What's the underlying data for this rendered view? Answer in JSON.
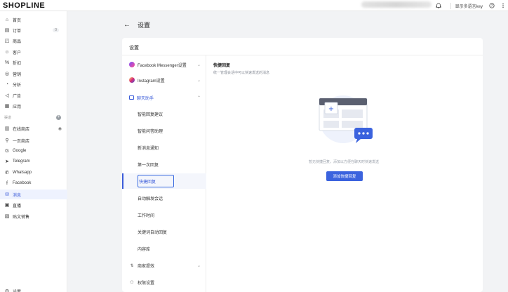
{
  "topbar": {
    "logo": "SHOPLINE",
    "lang_label": "显示多语言key",
    "icons": [
      "bell-icon",
      "help-icon",
      "more-icon"
    ]
  },
  "sidebar": {
    "items": [
      {
        "label": "首页",
        "icon": "home-icon"
      },
      {
        "label": "订单",
        "icon": "order-icon",
        "badge": "0"
      },
      {
        "label": "商品",
        "icon": "product-icon"
      },
      {
        "label": "客户",
        "icon": "customer-icon"
      },
      {
        "label": "折扣",
        "icon": "discount-icon"
      },
      {
        "label": "营销",
        "icon": "marketing-icon"
      },
      {
        "label": "分析",
        "icon": "analytics-icon"
      },
      {
        "label": "广告",
        "icon": "ads-icon"
      },
      {
        "label": "应用",
        "icon": "apps-icon"
      }
    ],
    "section_label": "渠道",
    "channels": [
      {
        "label": "在线商店",
        "icon": "store-icon"
      },
      {
        "label": "一页商店",
        "icon": "one-page-icon"
      },
      {
        "label": "Google",
        "icon": "google-icon"
      },
      {
        "label": "Telegram",
        "icon": "telegram-icon"
      },
      {
        "label": "Whatsapp",
        "icon": "whatsapp-icon"
      },
      {
        "label": "Facebook",
        "icon": "facebook-icon"
      },
      {
        "label": "消息",
        "icon": "message-icon",
        "active": true
      },
      {
        "label": "直播",
        "icon": "live-icon"
      },
      {
        "label": "贴文销售",
        "icon": "post-sale-icon"
      }
    ],
    "footer_label": "设置"
  },
  "page": {
    "title": "设置",
    "card_title": "设置"
  },
  "menu": {
    "items": [
      {
        "label": "Facebook Messenger设置",
        "icon": "messenger-icon",
        "type": "group"
      },
      {
        "label": "Instagram设置",
        "icon": "instagram-icon",
        "type": "group"
      },
      {
        "label": "聊天助手",
        "icon": "chat-assistant-icon",
        "type": "group-open"
      },
      {
        "label": "智能回复建议",
        "type": "sub"
      },
      {
        "label": "智能问答助理",
        "type": "sub"
      },
      {
        "label": "新消息通知",
        "type": "sub"
      },
      {
        "label": "第一次回复",
        "type": "sub"
      },
      {
        "label": "快捷回复",
        "type": "sub",
        "active": true
      },
      {
        "label": "自动触发会话",
        "type": "sub"
      },
      {
        "label": "工作时间",
        "type": "sub"
      },
      {
        "label": "关键词自动回复",
        "type": "sub"
      },
      {
        "label": "内容库",
        "type": "sub"
      },
      {
        "label": "商家提效",
        "icon": "efficiency-icon",
        "type": "group"
      },
      {
        "label": "权限设置",
        "icon": "permission-icon",
        "type": "group"
      }
    ]
  },
  "content": {
    "title": "快捷回复",
    "subtitle": "统一管理会话中可以快速发送的消息",
    "empty_text": "暂无快捷回复，添加以方便在聊天时快速发送",
    "add_button": "添加快捷回复"
  },
  "colors": {
    "accent": "#3b63de",
    "active_bg": "#eef2fe",
    "page_bg": "#f2f3f5"
  }
}
